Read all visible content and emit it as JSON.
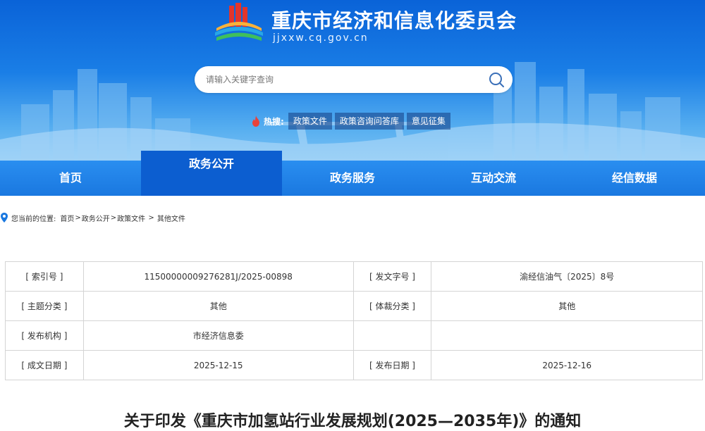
{
  "header": {
    "site_title": "重庆市经济和信息化委员会",
    "site_domain": "jjxxw.cq.gov.cn",
    "search_placeholder": "请输入关键字查询",
    "hot_label": "热搜:",
    "hot_tags": [
      "政策文件",
      "政策咨询问答库",
      "意见征集"
    ]
  },
  "nav": {
    "items": [
      "首页",
      "政务公开",
      "政务服务",
      "互动交流",
      "经信数据"
    ],
    "active_index": 1
  },
  "breadcrumb": {
    "prefix": "您当前的位置:",
    "items": [
      "首页",
      "政务公开",
      "政策文件",
      "其他文件"
    ],
    "separators": [
      ">",
      ">",
      " > "
    ]
  },
  "info": {
    "rows": [
      {
        "label1": "[ 索引号 ]",
        "value1": "11500000009276281J/2025-00898",
        "label2": "[ 发文字号 ]",
        "value2": "渝经信油气〔2025〕8号"
      },
      {
        "label1": "[ 主题分类 ]",
        "value1": "其他",
        "label2": "[ 体裁分类 ]",
        "value2": "其他"
      },
      {
        "label1": "[ 发布机构 ]",
        "value1": "市经济信息委",
        "label2": "",
        "value2": ""
      },
      {
        "label1": "[ 成文日期 ]",
        "value1": "2025-12-15",
        "label2": "[ 发布日期 ]",
        "value2": "2025-12-16"
      }
    ]
  },
  "article": {
    "title": "关于印发《重庆市加氢站行业发展规划(2025—2035年)》的通知"
  },
  "colors": {
    "banner_top": "#0a63d8",
    "nav_bg": "#1a78e0",
    "nav_active": "#0c5ed0",
    "hot_fire": "#e8413a"
  },
  "icons": {
    "logo": "cq-emblem-logo",
    "search": "search-icon",
    "hot": "fire-icon",
    "location": "location-pin-icon"
  }
}
